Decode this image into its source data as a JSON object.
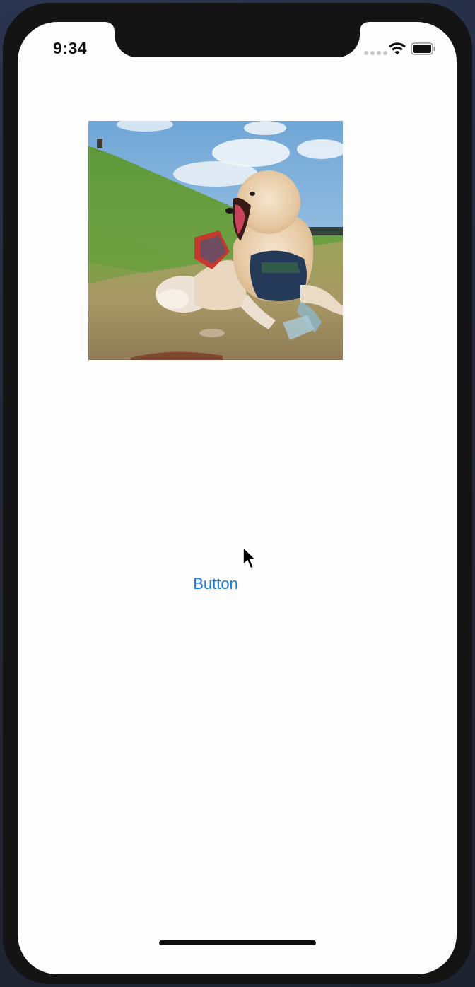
{
  "status_bar": {
    "time": "9:34",
    "signal_icon": "cellular-signal-icon",
    "wifi_icon": "wifi-icon",
    "battery_icon": "battery-icon"
  },
  "content": {
    "image_description_icon": "dog-photo",
    "button_label": "Button"
  },
  "colors": {
    "button_text": "#1a7fe0",
    "screen_background": "#fdfdfd",
    "device_bezel": "#141414"
  },
  "cursor_icon": "mouse-pointer-icon",
  "home_indicator_icon": "home-indicator-bar"
}
